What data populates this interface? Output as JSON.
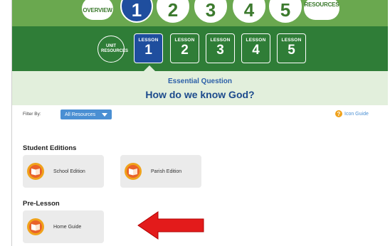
{
  "top_nav": {
    "overview": "OVERVIEW",
    "items": [
      "1",
      "2",
      "3",
      "4",
      "5"
    ],
    "resources": "RESOURCES",
    "active": "1"
  },
  "lesson_bar": {
    "unit_resources": "UNIT RESOURCES",
    "lessons": [
      {
        "label": "LESSON",
        "number": "1",
        "active": true
      },
      {
        "label": "LESSON",
        "number": "2",
        "active": false
      },
      {
        "label": "LESSON",
        "number": "3",
        "active": false
      },
      {
        "label": "LESSON",
        "number": "4",
        "active": false
      },
      {
        "label": "LESSON",
        "number": "5",
        "active": false
      }
    ]
  },
  "essential_question": {
    "label": "Essential Question",
    "question": "How do we know God?"
  },
  "filter": {
    "label": "Filter By:",
    "selected": "All Resources",
    "icon_guide": "Icon Guide"
  },
  "sections": [
    {
      "title": "Student Editions",
      "items": [
        "School Edition",
        "Parish Edition"
      ]
    },
    {
      "title": "Pre-Lesson",
      "items": [
        "Home Guide"
      ]
    }
  ],
  "colors": {
    "green_light": "#6aa84f",
    "green_dark": "#2f7d37",
    "blue_active": "#1f4e9e",
    "eq_bg": "#e2efdc",
    "arrow_red": "#e31b1b"
  },
  "icons": {
    "book": "open-book-icon",
    "help": "question-icon",
    "dropdown": "chevron-down-icon",
    "annotation": "red-arrow-icon"
  }
}
